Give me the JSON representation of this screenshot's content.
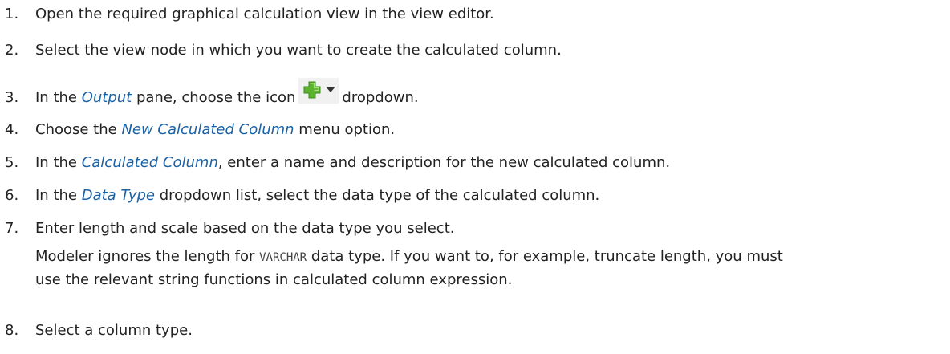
{
  "steps": [
    {
      "num": "1.",
      "text": "Open the required graphical calculation view in the view editor."
    },
    {
      "num": "2.",
      "text": "Select the view node in which you want to create the calculated column."
    },
    {
      "num": "3.",
      "pre": "In the ",
      "em": "Output",
      "mid": " pane, choose the icon",
      "post": "dropdown."
    },
    {
      "num": "4.",
      "pre": "Choose the ",
      "em": "New Calculated Column",
      "post": " menu option."
    },
    {
      "num": "5.",
      "pre": "In the ",
      "em": "Calculated Column",
      "post": ", enter a name and description for the new calculated column."
    },
    {
      "num": "6.",
      "pre": "In the ",
      "em": "Data Type",
      "post": " dropdown list, select the data type of the calculated column."
    },
    {
      "num": "7.",
      "text": "Enter length and scale based on the data type you select."
    },
    {
      "num": "8.",
      "text": "Select a column type."
    }
  ],
  "note": {
    "pre": "Modeler ignores the length for ",
    "code": "VARCHAR",
    "line1_post": " data type. If you want to, for example, truncate length, you must",
    "line2": "use the relevant string functions in calculated column expression."
  },
  "icons": {
    "add": "add-plus-icon",
    "dropdown": "caret-down-icon",
    "add_color": "#5cb32e"
  }
}
